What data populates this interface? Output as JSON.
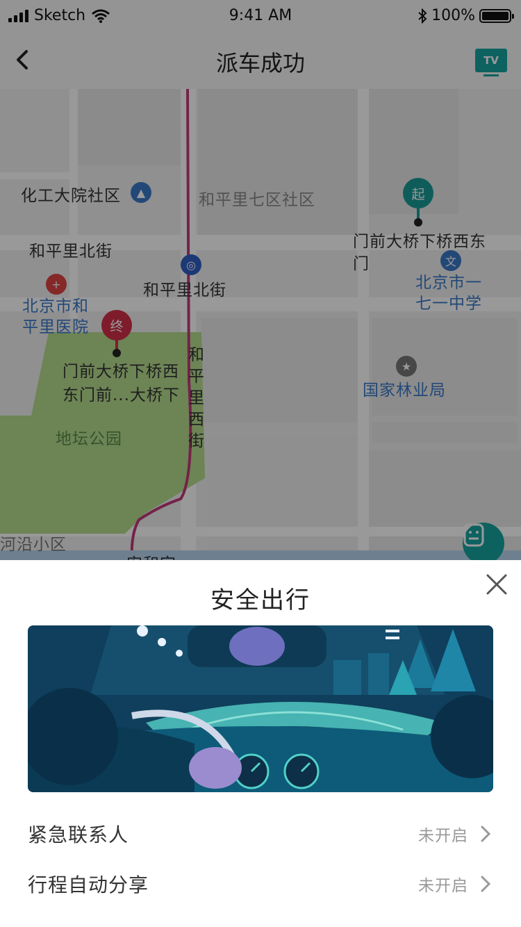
{
  "status_bar": {
    "carrier": "Sketch",
    "time": "9:41 AM",
    "battery": "100%"
  },
  "nav": {
    "title": "派车成功",
    "tv_label": "TV"
  },
  "map": {
    "labels": {
      "huagong": "化工大院社区",
      "hepingli7": "和平里七区社区",
      "hepingli_north_street_left": "和平里北街",
      "hepingli_north_street_mid": "和平里北街",
      "hospital": "北京市和平里医院",
      "school": "北京市一七一中学",
      "forestry": "国家林业局",
      "ditan": "地坛公园",
      "hepingli_west_street": "和平里西街",
      "heyan": "河沿小区",
      "bottom_partial": "安和宫"
    },
    "start_pin": {
      "glyph": "起",
      "address": "门前大桥下桥西东门"
    },
    "end_pin": {
      "glyph": "终",
      "address": "门前大桥下桥西东门前...大桥下"
    },
    "icons": {
      "service": "customer-service-icon"
    }
  },
  "sheet": {
    "title": "安全出行",
    "rows": [
      {
        "label": "紧急联系人",
        "value": "未开启"
      },
      {
        "label": "行程自动分享",
        "value": "未开启"
      }
    ]
  },
  "colors": {
    "accent": "#16a3a0",
    "end_pin": "#d4304a",
    "route": "#c23a7a",
    "park": "#b6dc8e"
  }
}
